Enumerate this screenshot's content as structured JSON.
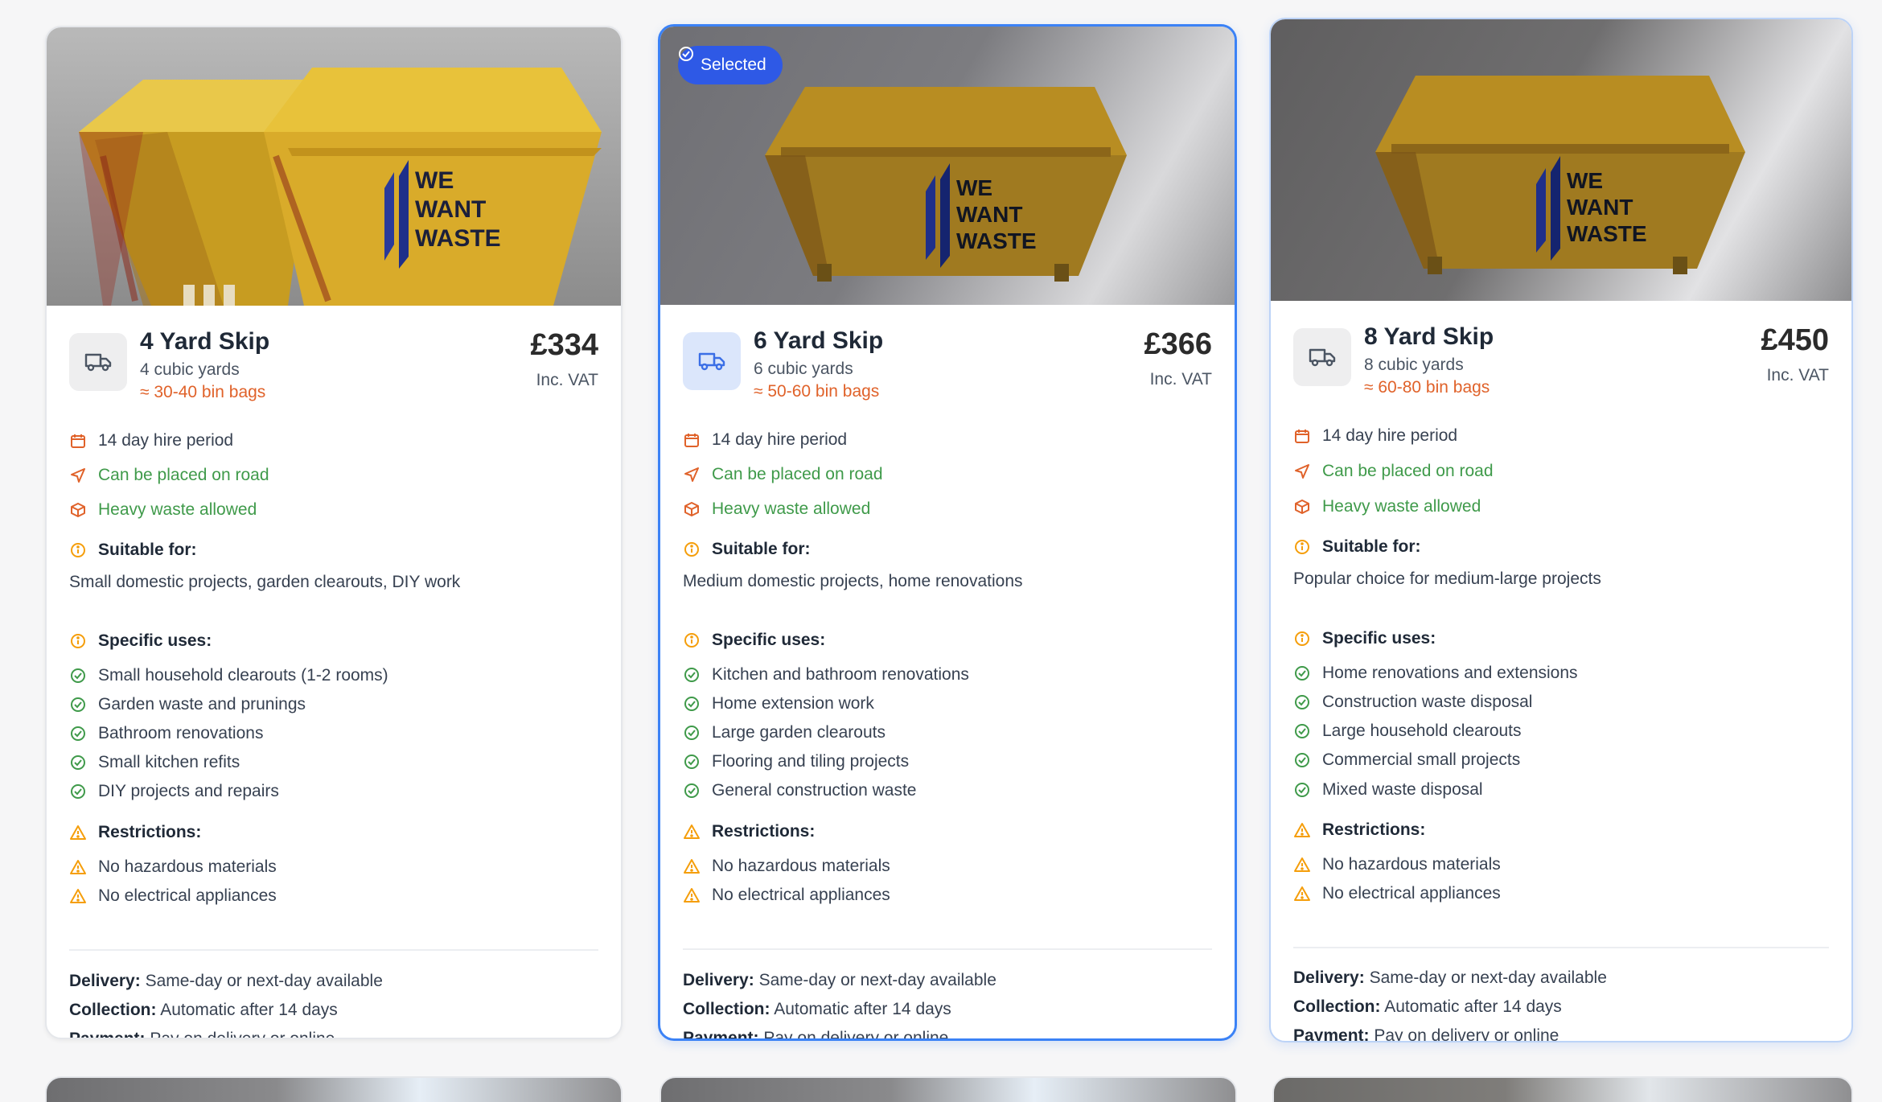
{
  "selected_badge": "Selected",
  "cards": [
    {
      "title": "4 Yard Skip",
      "capacity": "4 cubic yards",
      "bin_bags": "≈ 30-40 bin bags",
      "price": "£334",
      "vat": "Inc. VAT",
      "hire_period": "14 day hire period",
      "road": "Can be placed on road",
      "heavy": "Heavy waste allowed",
      "suitable_label": "Suitable for:",
      "suitable_desc": "Small domestic projects, garden clearouts, DIY work",
      "uses_label": "Specific uses:",
      "uses": [
        "Small household clearouts (1-2 rooms)",
        "Garden waste and prunings",
        "Bathroom renovations",
        "Small kitchen refits",
        "DIY projects and repairs"
      ],
      "restrictions_label": "Restrictions:",
      "restrictions": [
        "No hazardous materials",
        "No electrical appliances"
      ],
      "delivery_label": "Delivery:",
      "delivery": "Same-day or next-day available",
      "collection_label": "Collection:",
      "collection": "Automatic after 14 days",
      "payment_label": "Payment:",
      "payment": "Pay on delivery or online",
      "logo_text": [
        "WE",
        "WANT",
        "WASTE"
      ]
    },
    {
      "title": "6 Yard Skip",
      "capacity": "6 cubic yards",
      "bin_bags": "≈ 50-60 bin bags",
      "price": "£366",
      "vat": "Inc. VAT",
      "hire_period": "14 day hire period",
      "road": "Can be placed on road",
      "heavy": "Heavy waste allowed",
      "suitable_label": "Suitable for:",
      "suitable_desc": "Medium domestic projects, home renovations",
      "uses_label": "Specific uses:",
      "uses": [
        "Kitchen and bathroom renovations",
        "Home extension work",
        "Large garden clearouts",
        "Flooring and tiling projects",
        "General construction waste"
      ],
      "restrictions_label": "Restrictions:",
      "restrictions": [
        "No hazardous materials",
        "No electrical appliances"
      ],
      "delivery_label": "Delivery:",
      "delivery": "Same-day or next-day available",
      "collection_label": "Collection:",
      "collection": "Automatic after 14 days",
      "payment_label": "Payment:",
      "payment": "Pay on delivery or online",
      "logo_text": [
        "WE",
        "WANT",
        "WASTE"
      ]
    },
    {
      "title": "8 Yard Skip",
      "capacity": "8 cubic yards",
      "bin_bags": "≈ 60-80 bin bags",
      "price": "£450",
      "vat": "Inc. VAT",
      "hire_period": "14 day hire period",
      "road": "Can be placed on road",
      "heavy": "Heavy waste allowed",
      "suitable_label": "Suitable for:",
      "suitable_desc": "Popular choice for medium-large projects",
      "uses_label": "Specific uses:",
      "uses": [
        "Home renovations and extensions",
        "Construction waste disposal",
        "Large household clearouts",
        "Commercial small projects",
        "Mixed waste disposal"
      ],
      "restrictions_label": "Restrictions:",
      "restrictions": [
        "No hazardous materials",
        "No electrical appliances"
      ],
      "delivery_label": "Delivery:",
      "delivery": "Same-day or next-day available",
      "collection_label": "Collection:",
      "collection": "Automatic after 14 days",
      "payment_label": "Payment:",
      "payment": "Pay on delivery or online",
      "logo_text": [
        "WE",
        "WANT",
        "WASTE"
      ]
    }
  ],
  "colors": {
    "accent": "#3b82f6",
    "badge": "#2e59e6",
    "orange": "#e0622a",
    "green": "#3f9a4a",
    "warning": "#f59e0b",
    "skip_yellow": "#e4b52f"
  },
  "icons": {
    "truck": "truck-icon",
    "calendar": "calendar-icon",
    "road": "navigation-icon",
    "heavy": "package-icon",
    "info": "info-icon",
    "check": "check-circle-icon",
    "warning": "warning-triangle-icon"
  }
}
